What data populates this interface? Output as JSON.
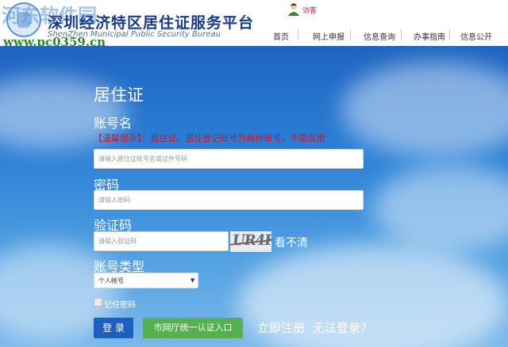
{
  "header": {
    "title": "深圳经济特区居住证服务平台",
    "subtitle": "ShenZhen Municipal Public Security Bureau",
    "watermark": "www.pc0359.cn",
    "watermark_logo": "河东软件园",
    "user_label": "访客"
  },
  "nav": [
    {
      "label": "首页"
    },
    {
      "label": "网上申报"
    },
    {
      "label": "信息查询"
    },
    {
      "label": "办事指南"
    },
    {
      "label": "信息公开"
    }
  ],
  "login": {
    "title": "居住证",
    "account_label": "账号名",
    "tip": "【温馨提示】：居住证、居住登记账号为两种账号，不能互用",
    "account_placeholder": "请输入居住证账号名或证件号码",
    "password_label": "密码",
    "password_placeholder": "请输入密码",
    "captcha_label": "验证码",
    "captcha_placeholder": "请输入验证码",
    "captcha_text": "UR4F",
    "captcha_refresh": "看不清",
    "account_type_label": "账号类型",
    "account_type_value": "个人帐号",
    "remember_label": "记住密码",
    "login_button": "登 录",
    "unified_button": "市网厅统一认证入口",
    "register_link": "立即注册",
    "forgot_link": "无法登录？"
  },
  "colors": {
    "brand": "#1a3b8c",
    "login_button": "#1c5fbf",
    "unified_button": "#55b04f",
    "tip": "#d4131e"
  }
}
